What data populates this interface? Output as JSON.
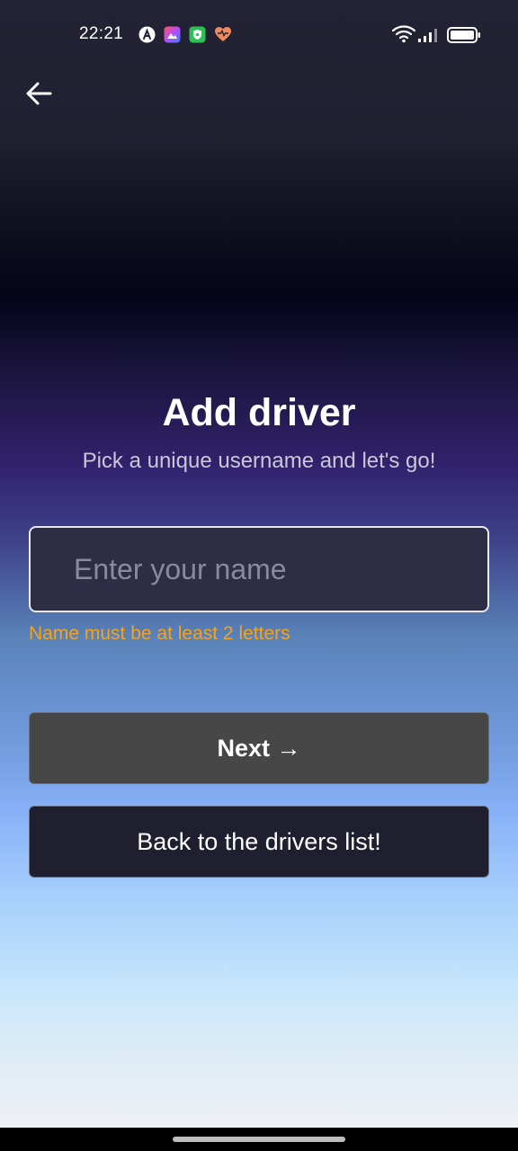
{
  "status_bar": {
    "time": "22:21",
    "notification_icons": [
      "app-a-icon",
      "photo-app-icon",
      "shield-app-icon",
      "heart-app-icon"
    ],
    "right_icons": [
      "wifi-icon",
      "signal-icon",
      "battery-icon"
    ]
  },
  "header": {
    "back_icon": "arrow-left-icon"
  },
  "form": {
    "title": "Add driver",
    "subtitle": "Pick a unique username and let's go!",
    "name_input": {
      "value": "",
      "placeholder": "Enter your name"
    },
    "error_message": "Name must be at least 2 letters",
    "next_button_label": "Next →",
    "back_button_label": "Back to the drivers list!"
  },
  "colors": {
    "error": "#f5a319",
    "next_button_bg": "#474747",
    "back_button_bg": "#201f30",
    "input_bg": "#2d2d45"
  }
}
